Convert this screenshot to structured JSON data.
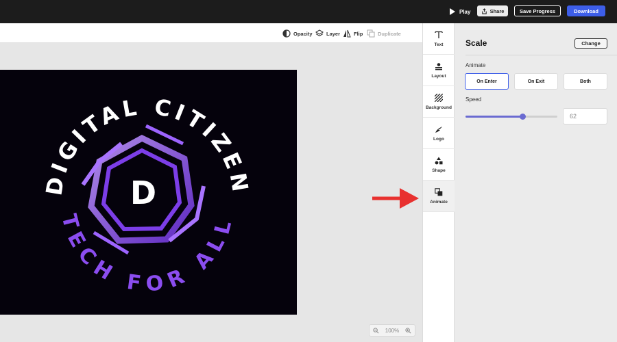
{
  "topbar": {
    "play_label": "Play",
    "share_label": "Share",
    "save_label": "Save Progress",
    "download_label": "Download"
  },
  "canvas_toolbar": {
    "opacity_label": "Opacity",
    "layer_label": "Layer",
    "flip_label": "Flip",
    "duplicate_label": "Duplicate"
  },
  "logo": {
    "top_text": "DIGITAL CITIZEN",
    "bottom_text": "TECH FOR ALL",
    "monogram": "D",
    "colors": {
      "background": "#05020c",
      "accent": "#8b4df0",
      "accent_light": "#a974ff",
      "white": "#ffffff"
    }
  },
  "zoom": {
    "level": "100%"
  },
  "rail": {
    "items": [
      {
        "label": "Text",
        "icon": "text-icon"
      },
      {
        "label": "Layout",
        "icon": "layout-icon"
      },
      {
        "label": "Background",
        "icon": "background-icon"
      },
      {
        "label": "Logo",
        "icon": "logo-icon"
      },
      {
        "label": "Shape",
        "icon": "shape-icon"
      },
      {
        "label": "Animate",
        "icon": "animate-icon",
        "active": true
      }
    ]
  },
  "panel": {
    "title": "Scale",
    "change_label": "Change",
    "animate_label": "Animate",
    "options": [
      {
        "label": "On Enter",
        "selected": true
      },
      {
        "label": "On Exit",
        "selected": false
      },
      {
        "label": "Both",
        "selected": false
      }
    ],
    "speed_label": "Speed",
    "speed_value": "62",
    "speed_fraction": 0.62
  },
  "colors": {
    "accent": "#3d5ee9",
    "slider": "#6a6bd1",
    "arrow": "#e8312f"
  }
}
